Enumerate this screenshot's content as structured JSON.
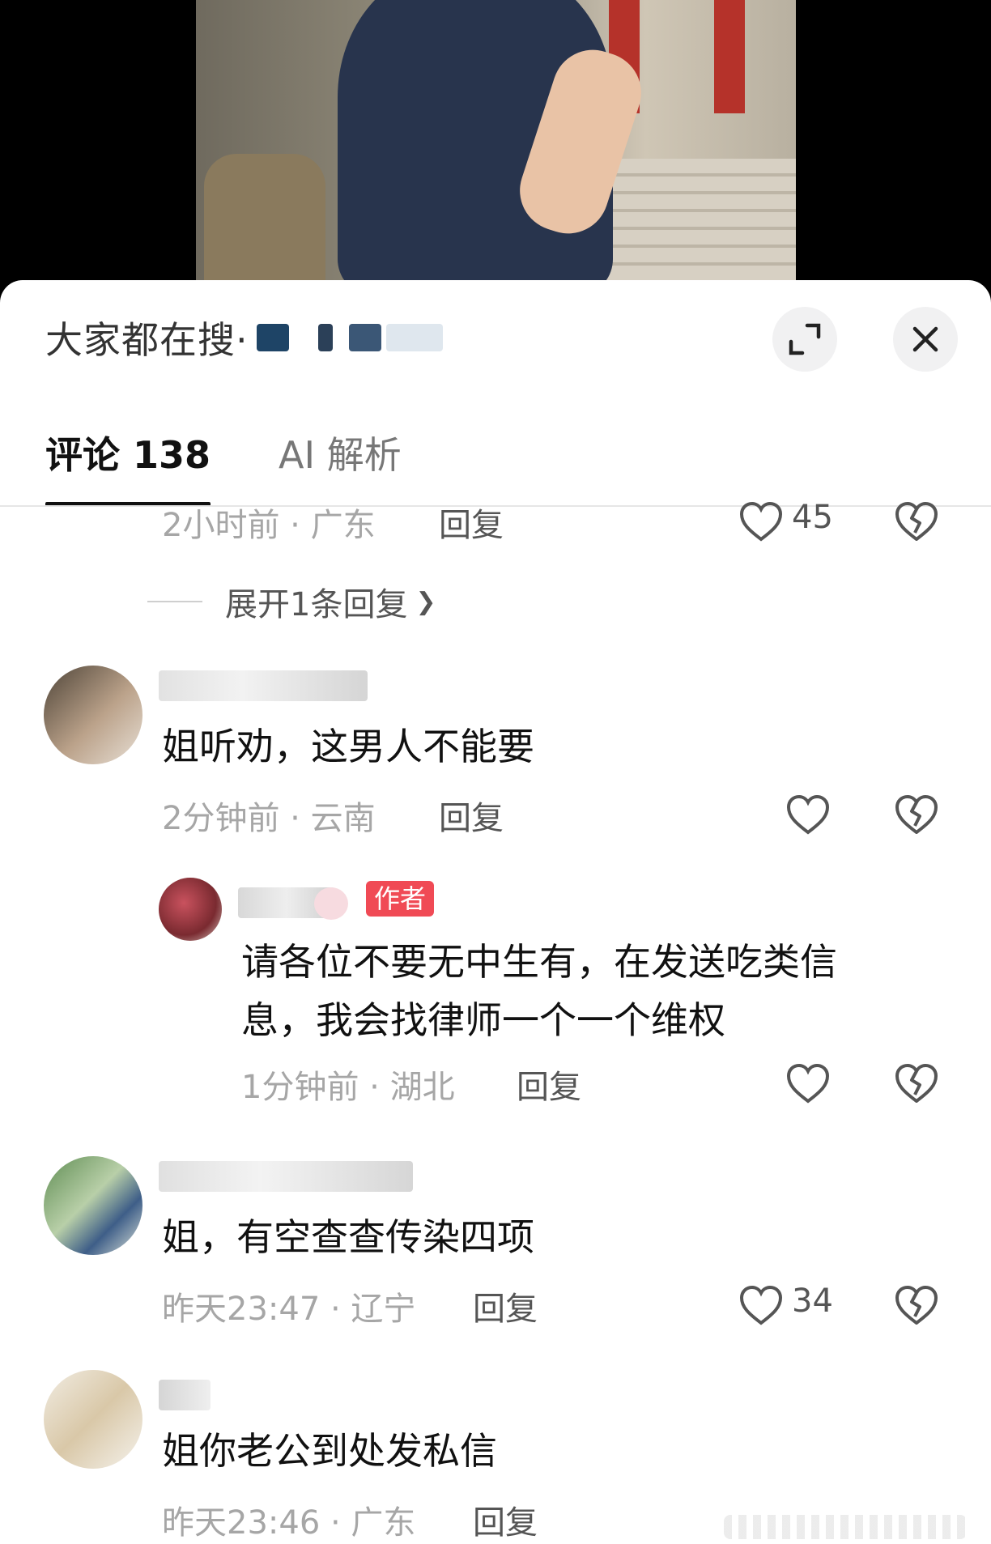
{
  "search": {
    "prefix": "大家都在搜·"
  },
  "tabs": [
    {
      "label": "评论 138"
    },
    {
      "label": "AI 解析"
    }
  ],
  "comments": [
    {
      "meta": "2小时前 · 广东",
      "reply": "回复",
      "likes": "45"
    },
    {
      "text": "姐听劝，这男人不能要",
      "meta": "2分钟前 · 云南",
      "reply": "回复"
    },
    {
      "badge": "作者",
      "text": "请各位不要无中生有，在发送吃类信息，我会找律师一个一个维权",
      "meta": "1分钟前 · 湖北",
      "reply": "回复"
    },
    {
      "text": "姐，有空查查传染四项",
      "meta": "昨天23:47 · 辽宁",
      "reply": "回复",
      "likes": "34"
    },
    {
      "text": "姐你老公到处发私信",
      "meta": "昨天23:46 · 广东",
      "reply": "回复"
    }
  ],
  "expand_replies": "展开1条回复",
  "icons": {
    "expand": "expand-icon",
    "close": "close-icon",
    "like": "heart-icon",
    "dislike": "broken-heart-icon",
    "chevron": "chevron-down-icon"
  }
}
